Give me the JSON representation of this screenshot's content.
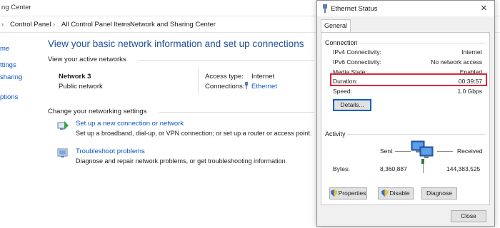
{
  "nsc": {
    "title_partial": "ng Center",
    "breadcrumbs": [
      "Control Panel",
      "All Control Panel Items",
      "Network and Sharing Center"
    ],
    "sidebar": [
      {
        "label": "me"
      },
      {
        "label": "ttings"
      },
      {
        "label": "sharing"
      },
      {
        "label": "ptions"
      }
    ],
    "main_title": "View your basic network information and set up connections",
    "active_networks_label": "View your active networks",
    "network": {
      "name": "Network 3",
      "type": "Public network",
      "access_type_label": "Access type:",
      "access_type_value": "Internet",
      "connections_label": "Connections:",
      "connections_value": "Ethernet"
    },
    "change_settings_label": "Change your networking settings",
    "tasks": [
      {
        "link": "Set up a new connection or network",
        "desc": "Set up a broadband, dial-up, or VPN connection; or set up a router or access point."
      },
      {
        "link": "Troubleshoot problems",
        "desc": "Diagnose and repair network problems, or get troubleshooting information."
      }
    ]
  },
  "dialog": {
    "title": "Ethernet Status",
    "close_glyph": "✕",
    "tab": "General",
    "connection_label": "Connection",
    "rows": [
      {
        "label": "IPv4 Connectivity:",
        "value": "Internet"
      },
      {
        "label": "IPv6 Connectivity:",
        "value": "No network access"
      },
      {
        "label": "Media State:",
        "value": "Enabled"
      },
      {
        "label": "Duration:",
        "value": "00:39:57"
      },
      {
        "label": "Speed:",
        "value": "1.0 Gbps"
      }
    ],
    "details_button": "Details...",
    "activity_label": "Activity",
    "sent_label": "Sent",
    "received_label": "Received",
    "bytes_label": "Bytes:",
    "bytes_sent": "8,360,887",
    "bytes_received": "144,383,525",
    "properties_button": "Properties",
    "disable_button": "Disable",
    "diagnose_button": "Diagnose",
    "close_button": "Close"
  },
  "colors": {
    "link": "#0a55c4",
    "title": "#1f4e99",
    "highlight": "#e1253a"
  }
}
